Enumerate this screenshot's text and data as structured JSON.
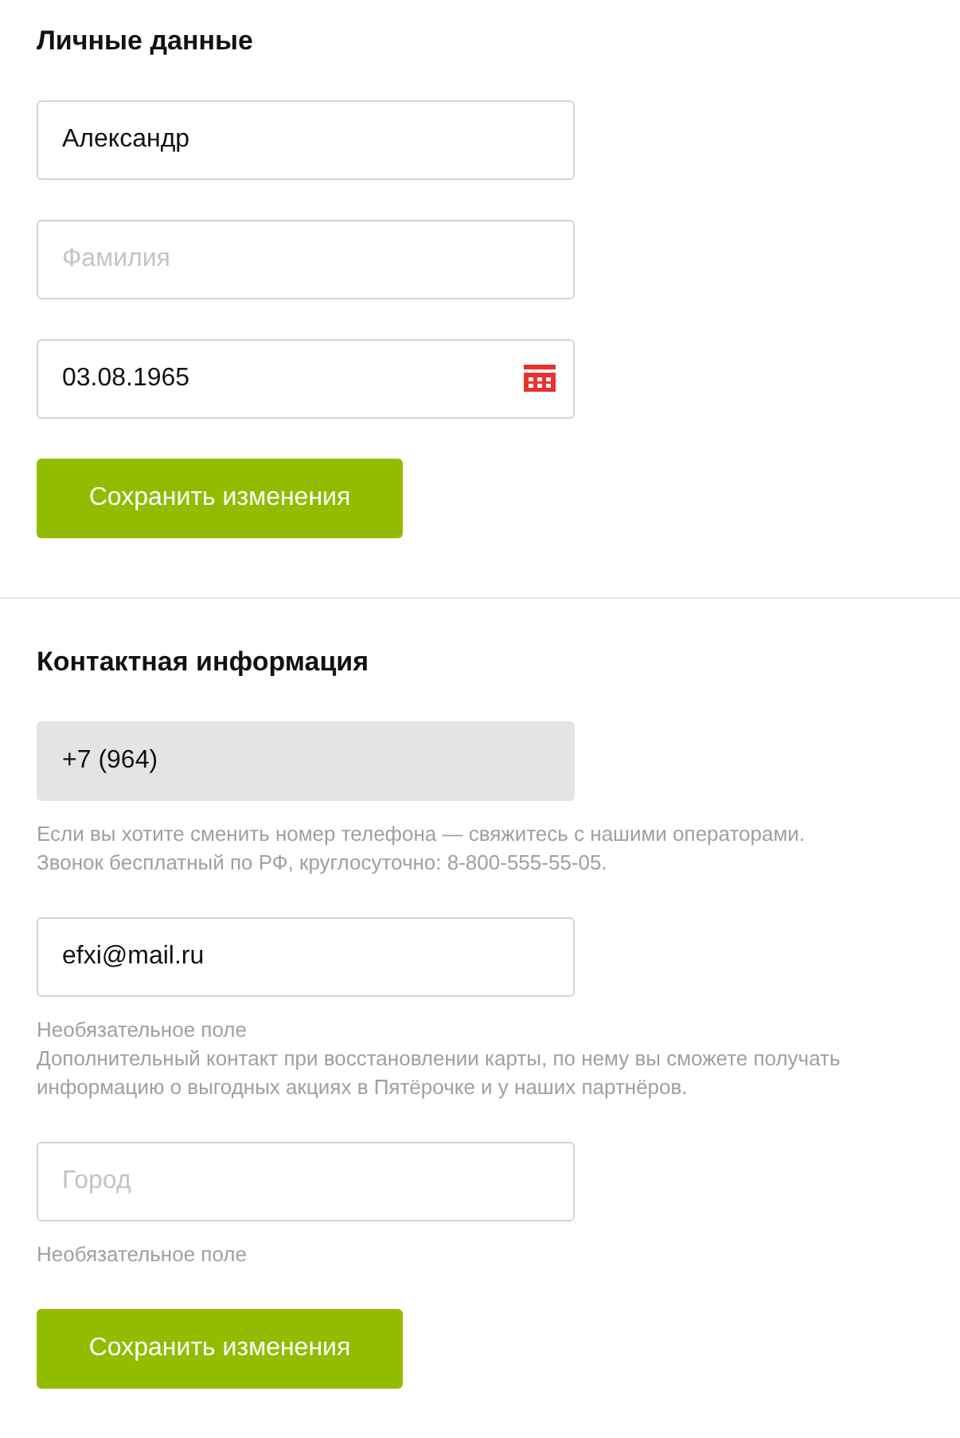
{
  "sections": [
    {
      "title": "Личные данные",
      "fields": [
        {
          "kind": "text",
          "value": "Александр",
          "disabled": false
        },
        {
          "kind": "text",
          "placeholder": "Фамилия",
          "disabled": false
        },
        {
          "kind": "date",
          "value": "03.08.1965",
          "disabled": false
        }
      ],
      "button": "Сохранить изменения"
    },
    {
      "title": "Контактная информация",
      "fields": [
        {
          "kind": "text",
          "value": "+7 (964)",
          "disabled": true,
          "hints": [
            "Если вы хотите сменить номер телефона — свяжитесь с нашими операторами.",
            "Звонок бесплатный по РФ, круглосуточно: 8-800-555-55-05."
          ]
        },
        {
          "kind": "text",
          "value": "efxi@mail.ru",
          "disabled": false,
          "hints": [
            "Необязательное поле",
            "Дополнительный контакт при восстановлении карты, по нему вы сможете получать информацию о выгодных акциях в Пятёрочке и у наших партнёров."
          ]
        },
        {
          "kind": "text",
          "placeholder": "Город",
          "disabled": false,
          "hints": [
            "Необязательное поле"
          ]
        }
      ],
      "button": "Сохранить изменения"
    }
  ]
}
